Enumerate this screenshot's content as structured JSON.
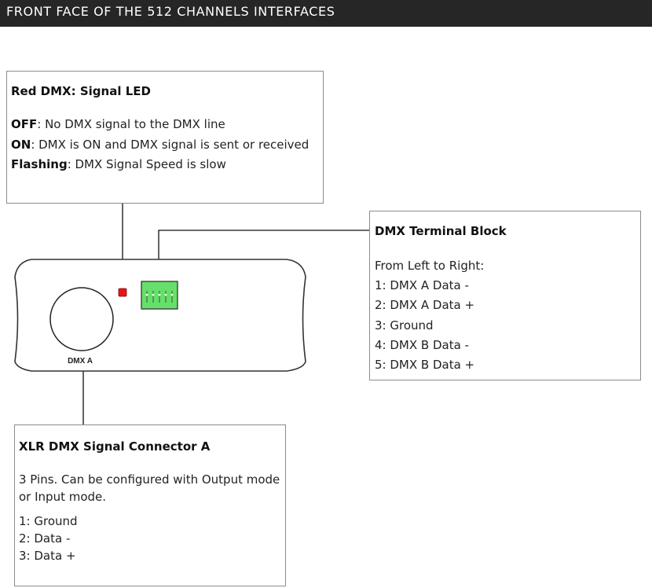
{
  "header": {
    "title": "FRONT FACE OF THE 512 CHANNELS INTERFACES"
  },
  "led_box": {
    "title": "Red DMX: Signal LED",
    "lines": [
      {
        "label": "OFF",
        "text": ": No DMX signal to the DMX line"
      },
      {
        "label": "ON",
        "text": ": DMX is ON and DMX signal is sent or received"
      },
      {
        "label": "Flashing",
        "text": ": DMX Signal Speed is slow"
      }
    ]
  },
  "terminal_box": {
    "title": "DMX Terminal Block",
    "intro": "From Left to Right:",
    "lines": [
      "1: DMX A Data -",
      "2: DMX A Data +",
      "3: Ground",
      "4: DMX B Data -",
      "5: DMX B Data +"
    ]
  },
  "xlr_box": {
    "title": "XLR DMX Signal Connector A",
    "desc_lines": [
      "3 Pins. Can be configured with Output mode",
      "or Input mode."
    ],
    "lines": [
      "1: Ground",
      "2: Data -",
      "3: Data +"
    ]
  },
  "device": {
    "port_label": "DMX A",
    "led_color": "#e8141b",
    "terminal_color": "#66e06a"
  }
}
